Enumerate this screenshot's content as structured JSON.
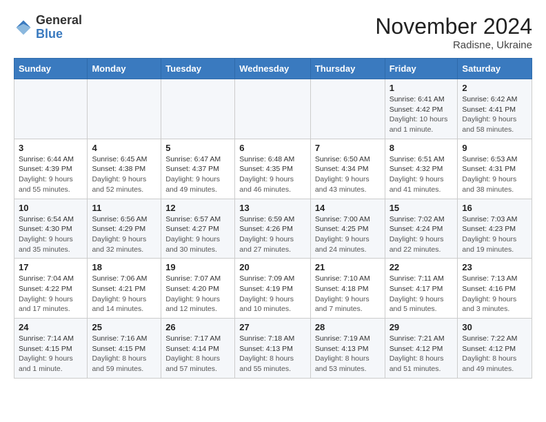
{
  "header": {
    "logo_general": "General",
    "logo_blue": "Blue",
    "month_title": "November 2024",
    "subtitle": "Radisne, Ukraine"
  },
  "weekdays": [
    "Sunday",
    "Monday",
    "Tuesday",
    "Wednesday",
    "Thursday",
    "Friday",
    "Saturday"
  ],
  "weeks": [
    [
      {
        "day": "",
        "sunrise": "",
        "sunset": "",
        "daylight": ""
      },
      {
        "day": "",
        "sunrise": "",
        "sunset": "",
        "daylight": ""
      },
      {
        "day": "",
        "sunrise": "",
        "sunset": "",
        "daylight": ""
      },
      {
        "day": "",
        "sunrise": "",
        "sunset": "",
        "daylight": ""
      },
      {
        "day": "",
        "sunrise": "",
        "sunset": "",
        "daylight": ""
      },
      {
        "day": "1",
        "sunrise": "Sunrise: 6:41 AM",
        "sunset": "Sunset: 4:42 PM",
        "daylight": "Daylight: 10 hours and 1 minute."
      },
      {
        "day": "2",
        "sunrise": "Sunrise: 6:42 AM",
        "sunset": "Sunset: 4:41 PM",
        "daylight": "Daylight: 9 hours and 58 minutes."
      }
    ],
    [
      {
        "day": "3",
        "sunrise": "Sunrise: 6:44 AM",
        "sunset": "Sunset: 4:39 PM",
        "daylight": "Daylight: 9 hours and 55 minutes."
      },
      {
        "day": "4",
        "sunrise": "Sunrise: 6:45 AM",
        "sunset": "Sunset: 4:38 PM",
        "daylight": "Daylight: 9 hours and 52 minutes."
      },
      {
        "day": "5",
        "sunrise": "Sunrise: 6:47 AM",
        "sunset": "Sunset: 4:37 PM",
        "daylight": "Daylight: 9 hours and 49 minutes."
      },
      {
        "day": "6",
        "sunrise": "Sunrise: 6:48 AM",
        "sunset": "Sunset: 4:35 PM",
        "daylight": "Daylight: 9 hours and 46 minutes."
      },
      {
        "day": "7",
        "sunrise": "Sunrise: 6:50 AM",
        "sunset": "Sunset: 4:34 PM",
        "daylight": "Daylight: 9 hours and 43 minutes."
      },
      {
        "day": "8",
        "sunrise": "Sunrise: 6:51 AM",
        "sunset": "Sunset: 4:32 PM",
        "daylight": "Daylight: 9 hours and 41 minutes."
      },
      {
        "day": "9",
        "sunrise": "Sunrise: 6:53 AM",
        "sunset": "Sunset: 4:31 PM",
        "daylight": "Daylight: 9 hours and 38 minutes."
      }
    ],
    [
      {
        "day": "10",
        "sunrise": "Sunrise: 6:54 AM",
        "sunset": "Sunset: 4:30 PM",
        "daylight": "Daylight: 9 hours and 35 minutes."
      },
      {
        "day": "11",
        "sunrise": "Sunrise: 6:56 AM",
        "sunset": "Sunset: 4:29 PM",
        "daylight": "Daylight: 9 hours and 32 minutes."
      },
      {
        "day": "12",
        "sunrise": "Sunrise: 6:57 AM",
        "sunset": "Sunset: 4:27 PM",
        "daylight": "Daylight: 9 hours and 30 minutes."
      },
      {
        "day": "13",
        "sunrise": "Sunrise: 6:59 AM",
        "sunset": "Sunset: 4:26 PM",
        "daylight": "Daylight: 9 hours and 27 minutes."
      },
      {
        "day": "14",
        "sunrise": "Sunrise: 7:00 AM",
        "sunset": "Sunset: 4:25 PM",
        "daylight": "Daylight: 9 hours and 24 minutes."
      },
      {
        "day": "15",
        "sunrise": "Sunrise: 7:02 AM",
        "sunset": "Sunset: 4:24 PM",
        "daylight": "Daylight: 9 hours and 22 minutes."
      },
      {
        "day": "16",
        "sunrise": "Sunrise: 7:03 AM",
        "sunset": "Sunset: 4:23 PM",
        "daylight": "Daylight: 9 hours and 19 minutes."
      }
    ],
    [
      {
        "day": "17",
        "sunrise": "Sunrise: 7:04 AM",
        "sunset": "Sunset: 4:22 PM",
        "daylight": "Daylight: 9 hours and 17 minutes."
      },
      {
        "day": "18",
        "sunrise": "Sunrise: 7:06 AM",
        "sunset": "Sunset: 4:21 PM",
        "daylight": "Daylight: 9 hours and 14 minutes."
      },
      {
        "day": "19",
        "sunrise": "Sunrise: 7:07 AM",
        "sunset": "Sunset: 4:20 PM",
        "daylight": "Daylight: 9 hours and 12 minutes."
      },
      {
        "day": "20",
        "sunrise": "Sunrise: 7:09 AM",
        "sunset": "Sunset: 4:19 PM",
        "daylight": "Daylight: 9 hours and 10 minutes."
      },
      {
        "day": "21",
        "sunrise": "Sunrise: 7:10 AM",
        "sunset": "Sunset: 4:18 PM",
        "daylight": "Daylight: 9 hours and 7 minutes."
      },
      {
        "day": "22",
        "sunrise": "Sunrise: 7:11 AM",
        "sunset": "Sunset: 4:17 PM",
        "daylight": "Daylight: 9 hours and 5 minutes."
      },
      {
        "day": "23",
        "sunrise": "Sunrise: 7:13 AM",
        "sunset": "Sunset: 4:16 PM",
        "daylight": "Daylight: 9 hours and 3 minutes."
      }
    ],
    [
      {
        "day": "24",
        "sunrise": "Sunrise: 7:14 AM",
        "sunset": "Sunset: 4:15 PM",
        "daylight": "Daylight: 9 hours and 1 minute."
      },
      {
        "day": "25",
        "sunrise": "Sunrise: 7:16 AM",
        "sunset": "Sunset: 4:15 PM",
        "daylight": "Daylight: 8 hours and 59 minutes."
      },
      {
        "day": "26",
        "sunrise": "Sunrise: 7:17 AM",
        "sunset": "Sunset: 4:14 PM",
        "daylight": "Daylight: 8 hours and 57 minutes."
      },
      {
        "day": "27",
        "sunrise": "Sunrise: 7:18 AM",
        "sunset": "Sunset: 4:13 PM",
        "daylight": "Daylight: 8 hours and 55 minutes."
      },
      {
        "day": "28",
        "sunrise": "Sunrise: 7:19 AM",
        "sunset": "Sunset: 4:13 PM",
        "daylight": "Daylight: 8 hours and 53 minutes."
      },
      {
        "day": "29",
        "sunrise": "Sunrise: 7:21 AM",
        "sunset": "Sunset: 4:12 PM",
        "daylight": "Daylight: 8 hours and 51 minutes."
      },
      {
        "day": "30",
        "sunrise": "Sunrise: 7:22 AM",
        "sunset": "Sunset: 4:12 PM",
        "daylight": "Daylight: 8 hours and 49 minutes."
      }
    ]
  ]
}
